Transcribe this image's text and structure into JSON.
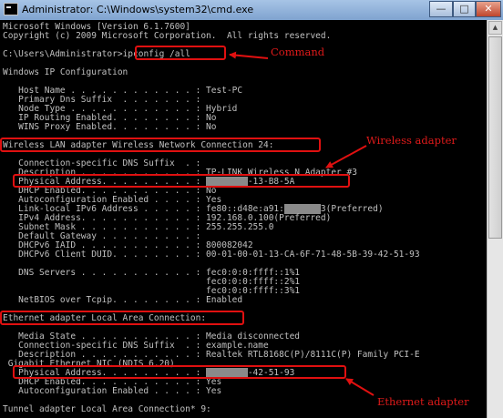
{
  "window": {
    "title": "Administrator: C:\\Windows\\system32\\cmd.exe",
    "controls": {
      "minimize": "—",
      "maximize": "□",
      "close": "✕"
    }
  },
  "console": {
    "lines": {
      "l1": "Microsoft Windows [Version 6.1.7600]",
      "l2": "Copyright (c) 2009 Microsoft Corporation.  All rights reserved.",
      "l4_prompt": "C:\\Users\\Administrator>",
      "l4_cmd": "ipconfig /all",
      "l6": "Windows IP Configuration",
      "l8": "   Host Name . . . . . . . . . . . . : Test-PC",
      "l9": "   Primary Dns Suffix  . . . . . . . :",
      "l10": "   Node Type . . . . . . . . . . . . : Hybrid",
      "l11": "   IP Routing Enabled. . . . . . . . : No",
      "l12": "   WINS Proxy Enabled. . . . . . . . : No",
      "l14": "Wireless LAN adapter Wireless Network Connection 24:",
      "l16": "   Connection-specific DNS Suffix  . :",
      "l17": "   Description . . . . . . . . . . . : TP-LINK Wireless N Adapter #3",
      "l18_a": "   Physical Address. . . . . . . . . : ",
      "l18_mask": "xx-xx-xx",
      "l18_b": "-13-B8-5A",
      "l19": "   DHCP Enabled. . . . . . . . . . . : No",
      "l20": "   Autoconfiguration Enabled . . . . : Yes",
      "l21_a": "   Link-local IPv6 Address . . . . . : fe80::d48e:a91:",
      "l21_mask": "xxxxxxx",
      "l21_b": "3(Preferred)",
      "l22": "   IPv4 Address. . . . . . . . . . . : 192.168.0.100(Preferred)",
      "l23": "   Subnet Mask . . . . . . . . . . . : 255.255.255.0",
      "l24": "   Default Gateway . . . . . . . . . :",
      "l25": "   DHCPv6 IAID . . . . . . . . . . . : 800082042",
      "l26": "   DHCPv6 Client DUID. . . . . . . . : 00-01-00-01-13-CA-6F-71-48-5B-39-42-51-93",
      "l28": "   DNS Servers . . . . . . . . . . . : fec0:0:0:ffff::1%1",
      "l29": "                                       fec0:0:0:ffff::2%1",
      "l30": "                                       fec0:0:0:ffff::3%1",
      "l31": "   NetBIOS over Tcpip. . . . . . . . : Enabled",
      "l33": "Ethernet adapter Local Area Connection:",
      "l35": "   Media State . . . . . . . . . . . : Media disconnected",
      "l36": "   Connection-specific DNS Suffix  . : example.name",
      "l37": "   Description . . . . . . . . . . . : Realtek RTL8168C(P)/8111C(P) Family PCI-E",
      "l38": " Gigabit Ethernet NIC (NDIS 6.20)",
      "l39_a": "   Physical Address. . . . . . . . . : ",
      "l39_mask": "xx-xx-xx",
      "l39_b": "-42-51-93",
      "l40": "   DHCP Enabled. . . . . . . . . . . : Yes",
      "l41": "   Autoconfiguration Enabled . . . . : Yes",
      "l43": "Tunnel adapter Local Area Connection* 9:"
    }
  },
  "annotations": {
    "command": "Command",
    "wireless": "Wireless adapter",
    "ethernet": "Ethernet adapter"
  },
  "colors": {
    "console_bg": "#000000",
    "console_text": "#c0c0c0",
    "annotation_red": "#e01010"
  }
}
